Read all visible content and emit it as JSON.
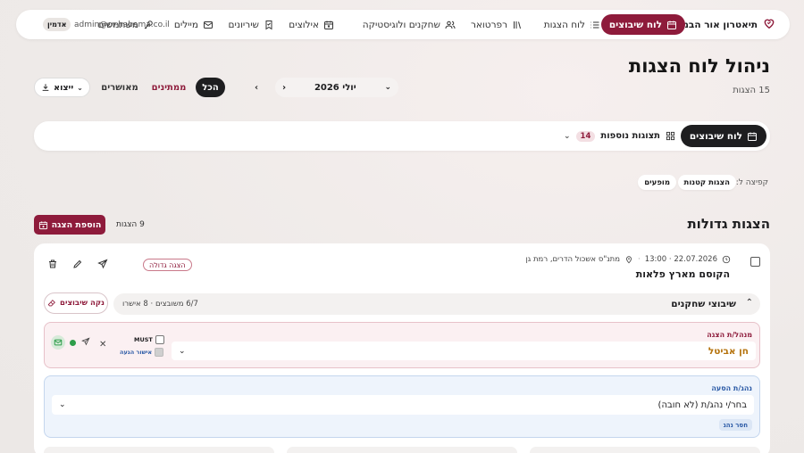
{
  "colors": {
    "brand": "#8e1b3b",
    "dark": "#1e1e20",
    "accent_gold": "#b5730e",
    "blue": "#2b5aa6",
    "green": "#2e9d4a"
  },
  "nav": {
    "brand": "תיאטרון אור הבמה",
    "admin_badge": "אדמין",
    "email": "admin@or-habama.co.il",
    "items": [
      {
        "label": "לוח שיבוצים",
        "icon": "calendar-icon",
        "active": true
      },
      {
        "label": "לוח הצגות",
        "icon": "list-icon"
      },
      {
        "label": "רפרטואר",
        "icon": "books-icon"
      },
      {
        "label": "שחקנים ולוגיסטיקה",
        "icon": "users-icon"
      },
      {
        "label": "אילוצים",
        "icon": "calendar-x-icon"
      },
      {
        "label": "שיריונים",
        "icon": "bookmark-icon"
      },
      {
        "label": "מיילים",
        "icon": "mail-icon"
      },
      {
        "label": "משתמשים",
        "icon": "key-icon"
      }
    ]
  },
  "header": {
    "title": "ניהול לוח הצגות",
    "count": "15 הצגות"
  },
  "filters": {
    "all": "הכל",
    "pending": "ממתינים",
    "approved": "מאושרים",
    "month": "יולי 2026",
    "export": "ייצוא"
  },
  "toolbar": {
    "schedule_button": "לוח שיבוצים",
    "more_shows": "תצוגות נוספות",
    "more_count": "14"
  },
  "jump": {
    "label": "קפיצה ל:",
    "chips": [
      "הצגות קטנות",
      "מופעים"
    ]
  },
  "section": {
    "title": "הצגות גדולות",
    "count": "9 הצגות",
    "add_button": "הוספת הצגה"
  },
  "show": {
    "datetime": "22.07.2026 · 13:00",
    "location": "מתנ\"ס אשכול הדרים, רמת גן",
    "name": "הקוסם מארץ פלאות",
    "tag": "הצגה גדולה",
    "cast_title": "שיבוצי שחקנים",
    "cast_stats": "6/7 משובצים · 8 אישרו",
    "clear_button": "נקה שיבוצים",
    "role1": {
      "label": "מנהל/ת הצגה",
      "value": "חן אביטל",
      "must": "MUST",
      "approve": "אישור הגעה"
    },
    "role2": {
      "label": "נהג/ת הסעה",
      "placeholder": "בחר/י נהג/ת (לא חובה)",
      "missing": "חסר נהג"
    }
  }
}
